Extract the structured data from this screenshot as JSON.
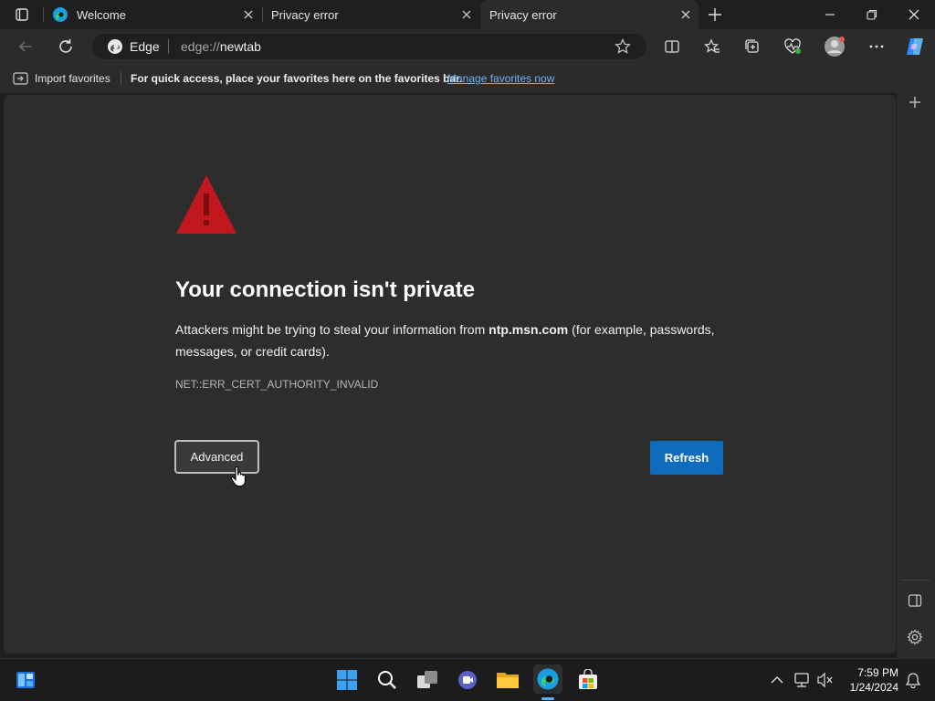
{
  "tabs": [
    {
      "label": "Welcome"
    },
    {
      "label": "Privacy error"
    },
    {
      "label": "Privacy error"
    }
  ],
  "addressbar": {
    "site_label": "Edge",
    "url_scheme": "edge://",
    "url_host": "newtab"
  },
  "favorites_bar": {
    "import_label": "Import favorites",
    "message": "For quick access, place your favorites here on the favorites bar.",
    "manage_link": "Manage favorites now"
  },
  "error_page": {
    "title": "Your connection isn't private",
    "body_prefix": "Attackers might be trying to steal your information from ",
    "host": "ntp.msn.com",
    "body_suffix": " (for example, passwords,",
    "body_line2": "messages, or credit cards).",
    "error_code": "NET::ERR_CERT_AUTHORITY_INVALID",
    "advanced_label": "Advanced",
    "refresh_label": "Refresh"
  },
  "clock": {
    "time": "7:59 PM",
    "date": "1/24/2024"
  },
  "colors": {
    "accent": "#0f6cbd",
    "warning_red": "#c0181d",
    "link": "#6cb4f5"
  }
}
